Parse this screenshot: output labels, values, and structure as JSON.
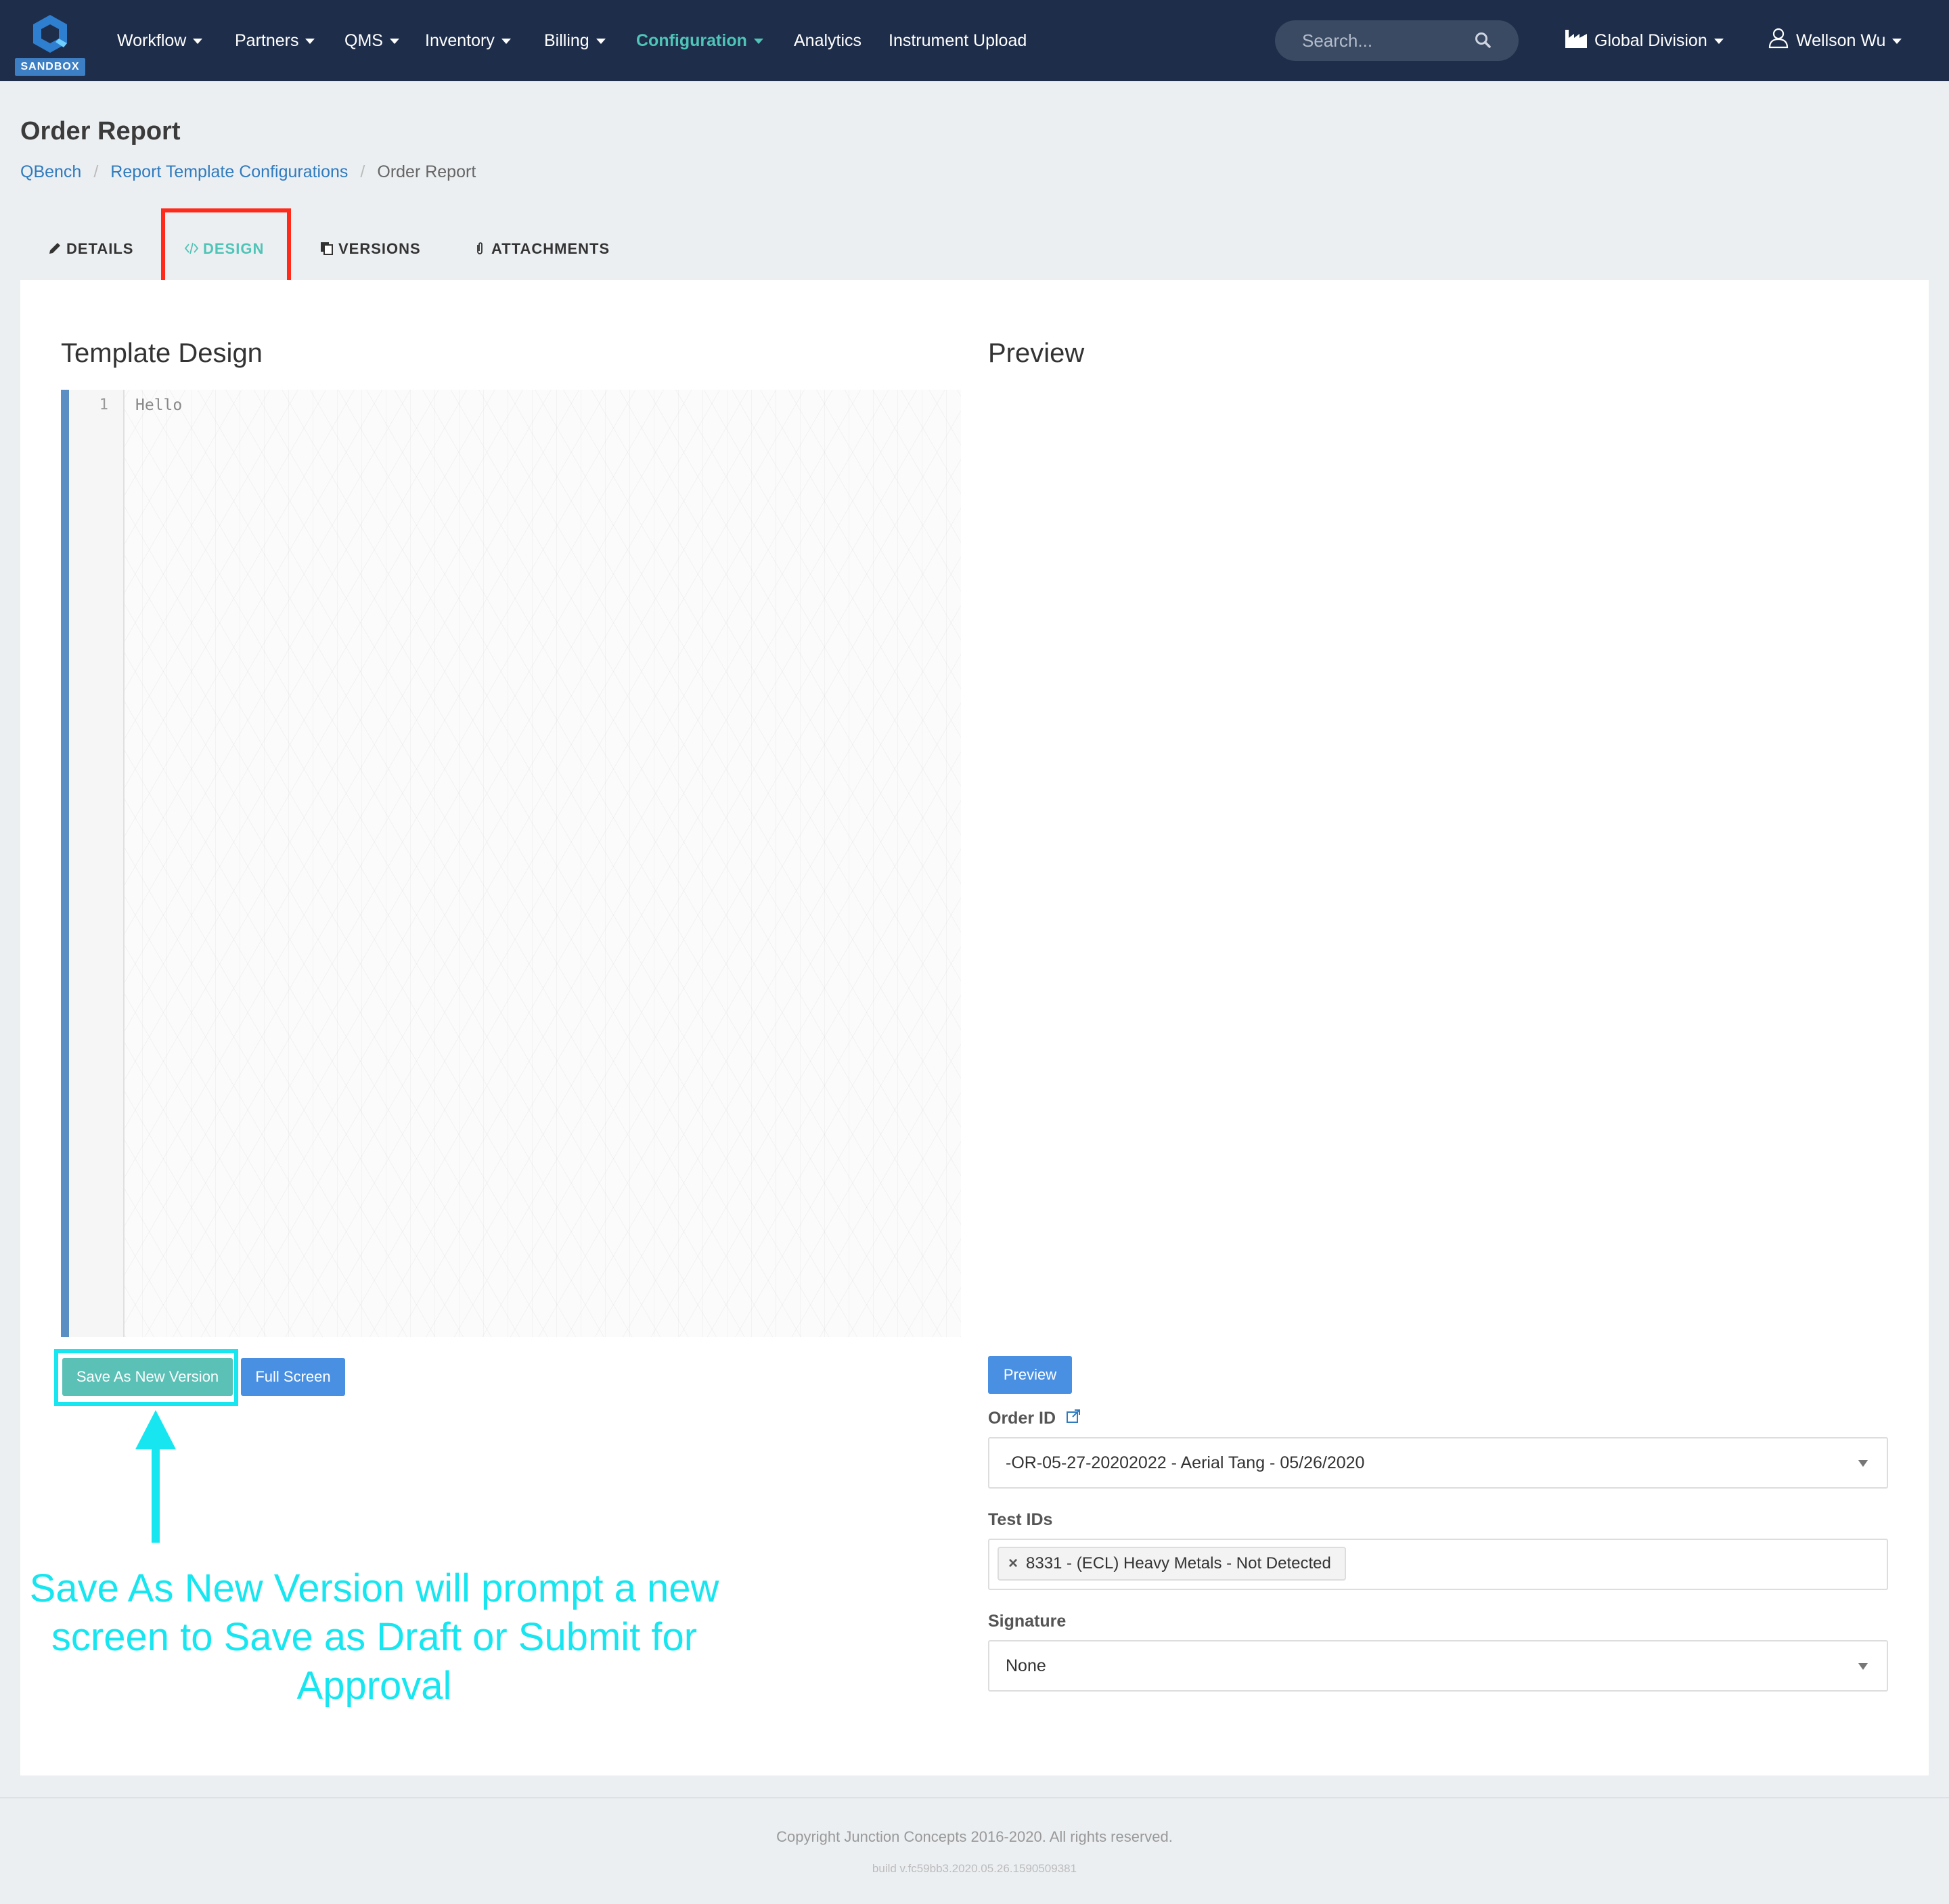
{
  "nav": {
    "badge": "SANDBOX",
    "items": [
      {
        "label": "Workflow",
        "dropdown": true
      },
      {
        "label": "Partners",
        "dropdown": true
      },
      {
        "label": "QMS",
        "dropdown": true
      },
      {
        "label": "Inventory",
        "dropdown": true
      },
      {
        "label": "Billing",
        "dropdown": true
      },
      {
        "label": "Configuration",
        "dropdown": true,
        "active": true
      },
      {
        "label": "Analytics",
        "dropdown": false
      },
      {
        "label": "Instrument Upload",
        "dropdown": false
      }
    ],
    "search_placeholder": "Search...",
    "division": "Global Division",
    "user": "Wellson Wu"
  },
  "page": {
    "title": "Order Report",
    "breadcrumb": [
      "QBench",
      "Report Template Configurations",
      "Order Report"
    ]
  },
  "tabs": [
    {
      "label": "DETAILS",
      "icon": "pencil-icon"
    },
    {
      "label": "DESIGN",
      "icon": "code-icon",
      "active": true
    },
    {
      "label": "VERSIONS",
      "icon": "copy-icon"
    },
    {
      "label": "ATTACHMENTS",
      "icon": "paperclip-icon"
    }
  ],
  "design": {
    "title": "Template Design",
    "line_number": "1",
    "code": "Hello",
    "save_button": "Save As New Version",
    "fullscreen_button": "Full Screen"
  },
  "annotation": {
    "text": "Save As New Version will prompt a new screen to Save as Draft or Submit for Approval"
  },
  "preview": {
    "title": "Preview",
    "button": "Preview",
    "order_label": "Order ID",
    "order_value": "-OR-05-27-20202022 - Aerial Tang - 05/26/2020",
    "tests_label": "Test IDs",
    "test_tag": "8331 - (ECL) Heavy Metals - Not Detected",
    "signature_label": "Signature",
    "signature_value": "None"
  },
  "footer": {
    "copyright": "Copyright Junction Concepts 2016-2020. All rights reserved.",
    "build": "build v.fc59bb3.2020.05.26.1590509381"
  },
  "colors": {
    "nav_bg": "#1e2d4a",
    "accent_teal": "#4fc4b7",
    "button_blue": "#4a90e2",
    "highlight_red": "#ff2a1a",
    "highlight_cyan": "#17e6f0"
  }
}
